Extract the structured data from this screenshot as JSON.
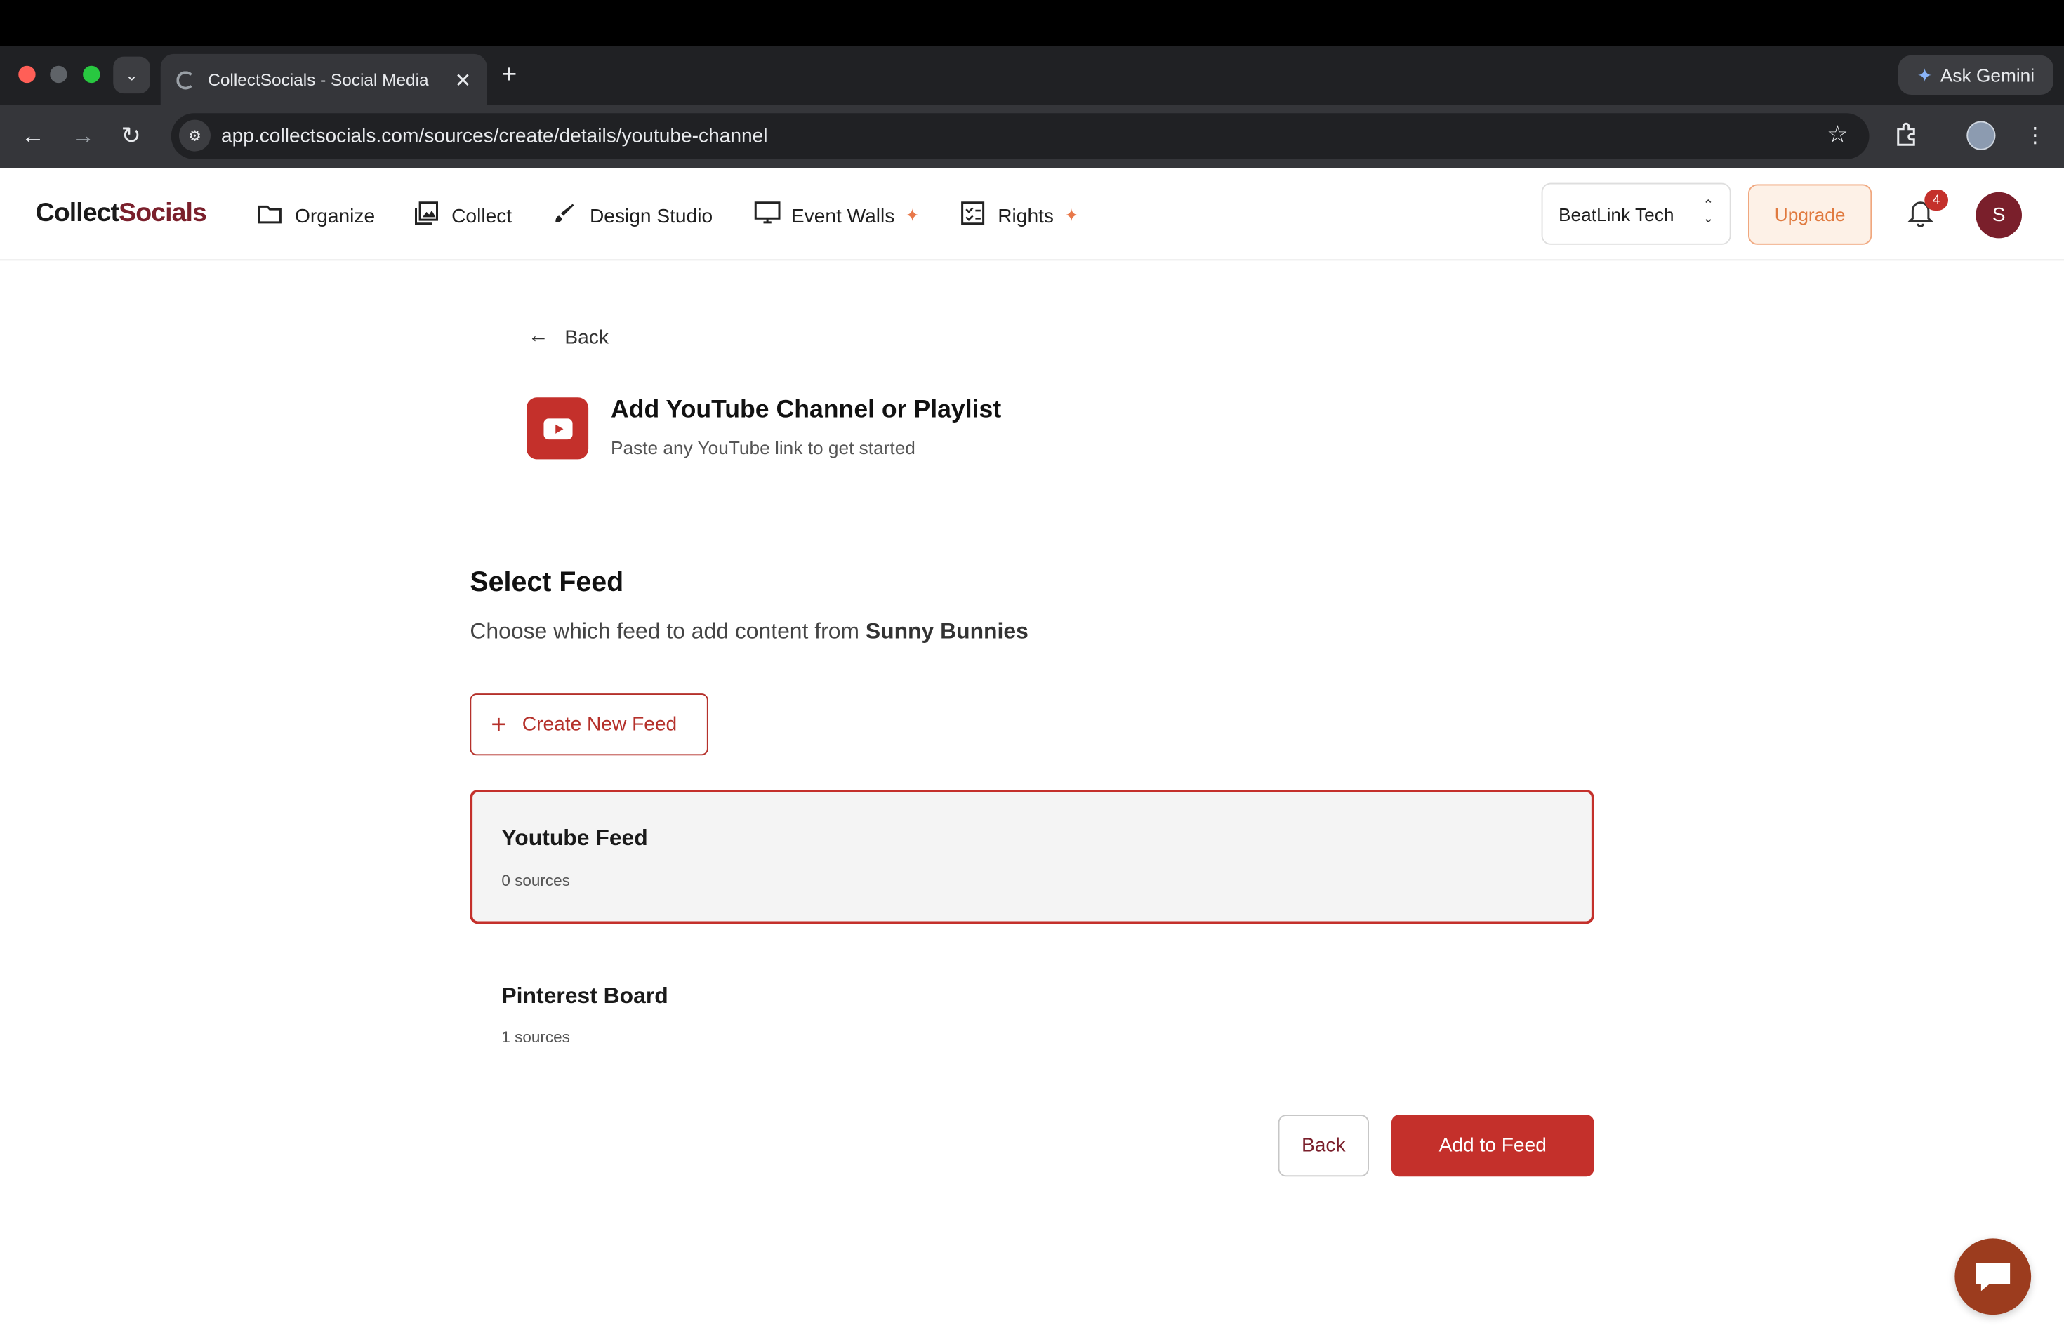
{
  "browser": {
    "tab_title": "CollectSocials - Social Media",
    "new_tab_glyph": "+",
    "close_glyph": "✕",
    "url": "app.collectsocials.com/sources/create/details/youtube-channel",
    "gemini_label": "Ask Gemini"
  },
  "header": {
    "logo_prefix": "C",
    "logo_mid": "ollect",
    "logo_accent": "Socials",
    "nav": [
      {
        "label": "Organize",
        "icon": "folder-icon"
      },
      {
        "label": "Collect",
        "icon": "image-gallery-icon"
      },
      {
        "label": "Design Studio",
        "icon": "brush-icon"
      },
      {
        "label": "Event Walls",
        "icon": "monitor-icon",
        "sparkle": true
      },
      {
        "label": "Rights",
        "icon": "checklist-icon",
        "sparkle": true
      }
    ],
    "workspace": "BeatLink Tech",
    "upgrade_label": "Upgrade",
    "notification_count": "4",
    "avatar_initial": "S"
  },
  "page": {
    "back_label": "Back",
    "title": "Add YouTube Channel or Playlist",
    "subtitle": "Paste any YouTube link to get started",
    "section_title": "Select Feed",
    "section_desc_prefix": "Choose which feed to add content from ",
    "section_desc_name": "Sunny Bunnies",
    "create_feed_label": "Create New Feed",
    "feeds": [
      {
        "name": "Youtube Feed",
        "count": "0 sources",
        "selected": true
      },
      {
        "name": "Pinterest Board",
        "count": "1 sources",
        "selected": false
      }
    ],
    "footer_back_label": "Back",
    "add_label": "Add to Feed"
  },
  "colors": {
    "brand": "#c4302b",
    "brand_dark": "#7a1f2b",
    "upgrade_accent": "#e07a3f"
  }
}
